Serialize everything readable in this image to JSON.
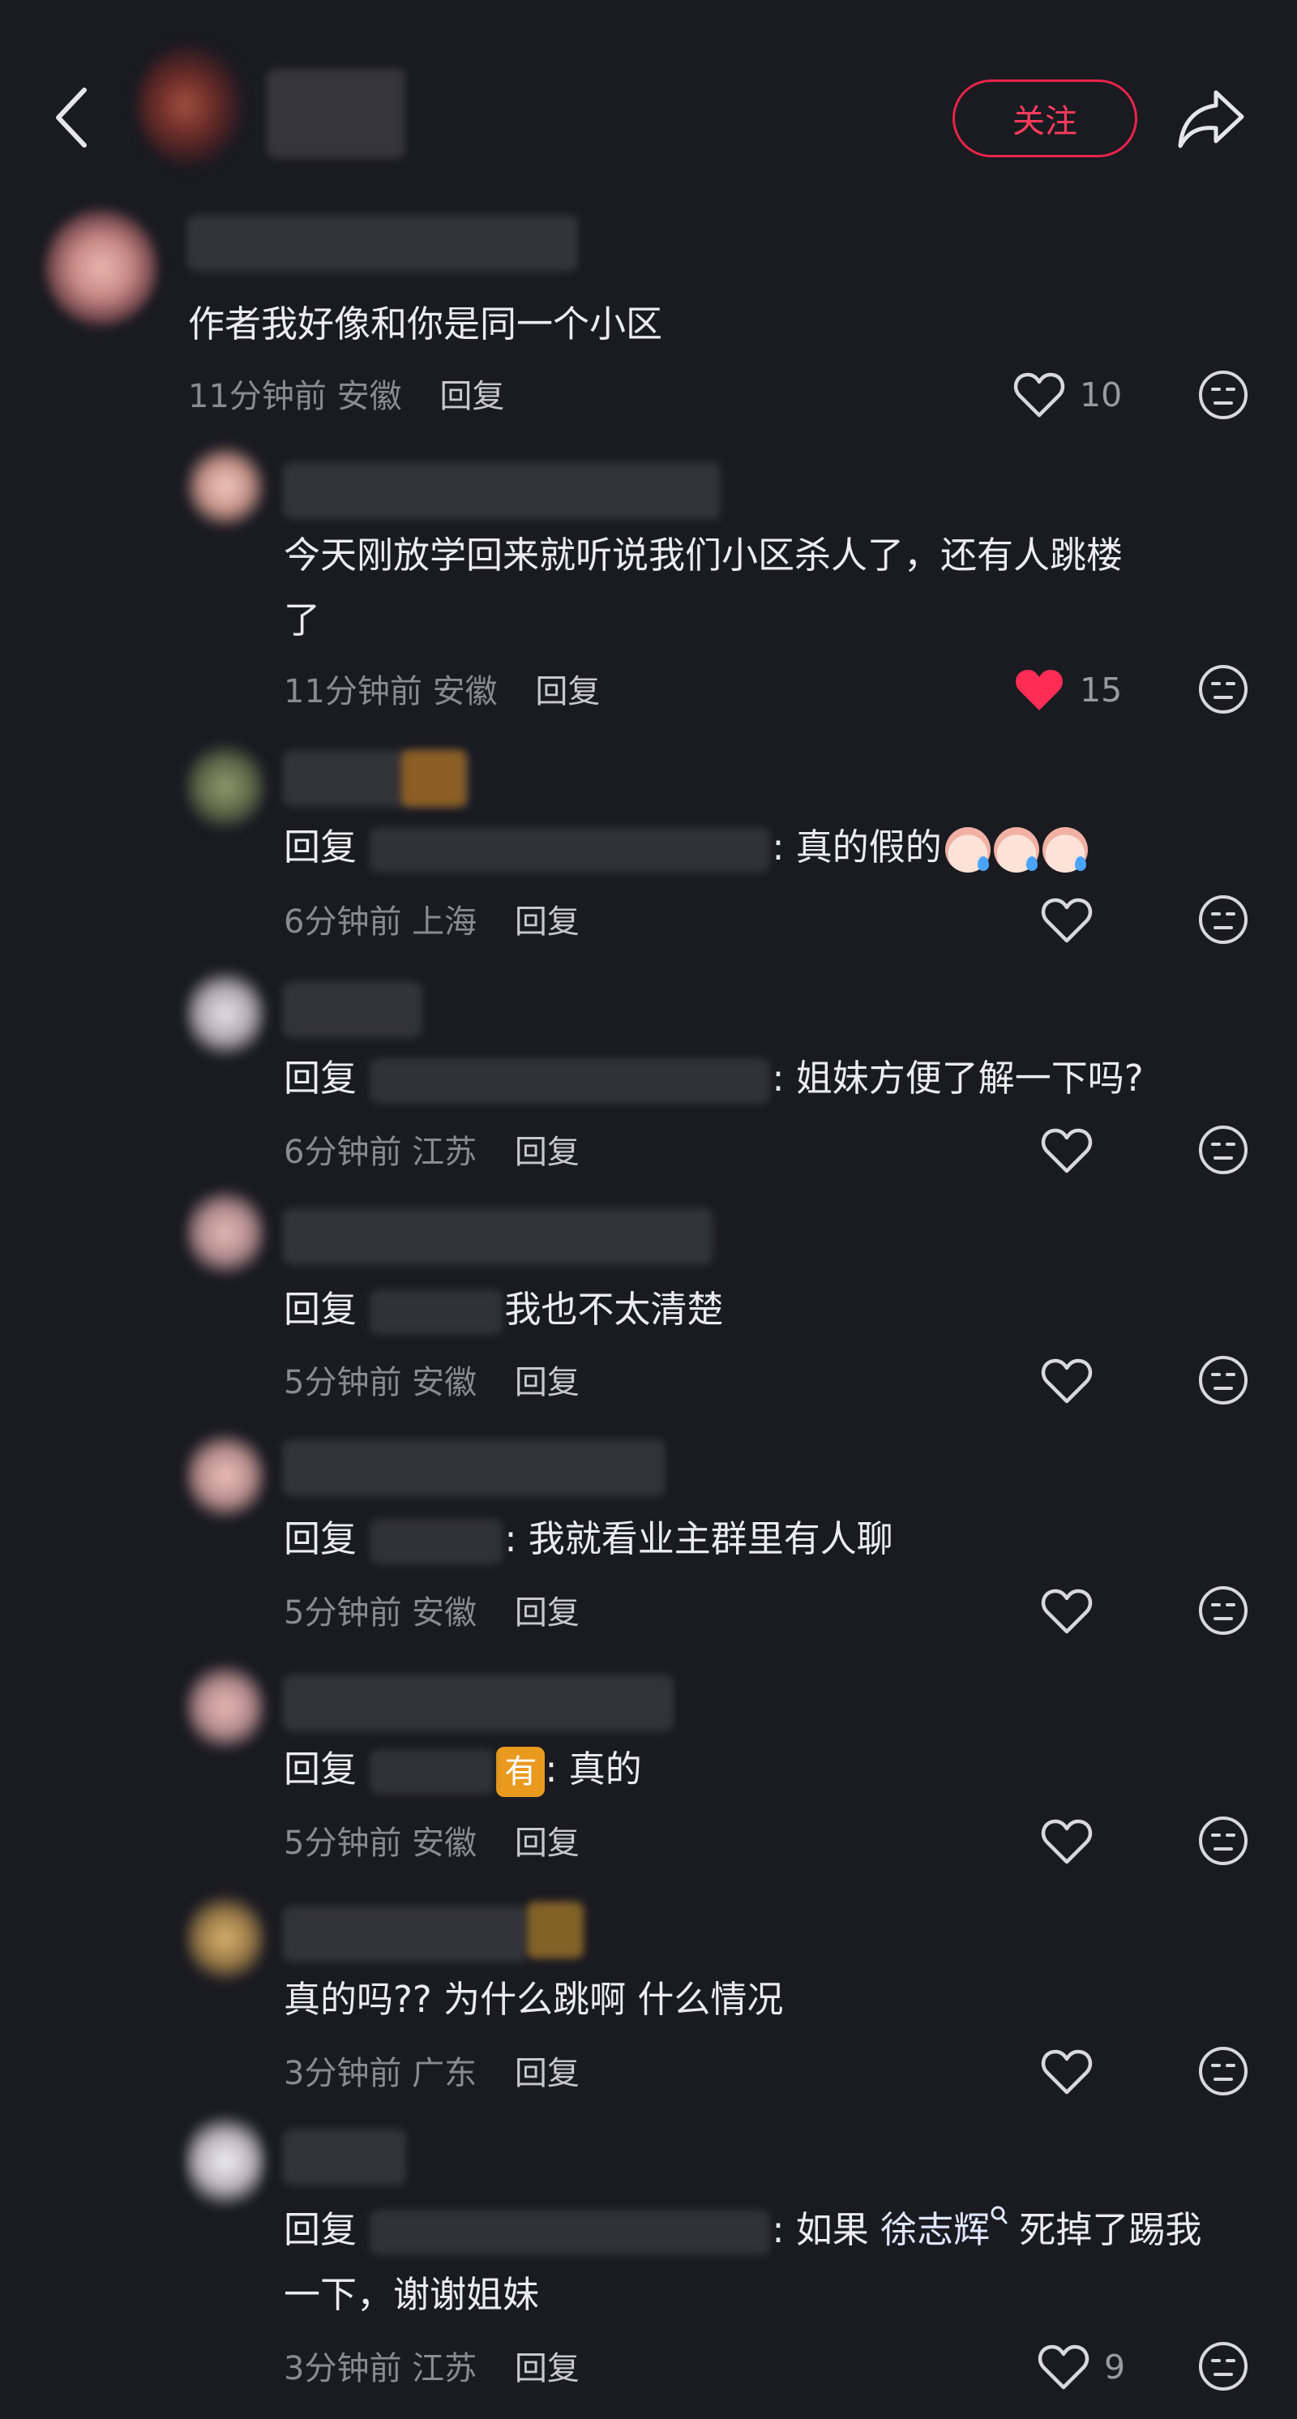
{
  "header": {
    "follow_label": "关注"
  },
  "main_comment": {
    "text": "作者我好像和你是同一个小区",
    "time": "11分钟前",
    "location": "安徽",
    "reply_label": "回复",
    "likes": "10"
  },
  "replies": [
    {
      "line1": "今天刚放学回来就听说我们小区杀人了，还有人跳楼",
      "line2": "了",
      "time": "11分钟前",
      "location": "安徽",
      "reply_label": "回复",
      "likes": "15",
      "liked": true
    },
    {
      "prefix": "回复",
      "body": ": 真的假的",
      "time": "6分钟前",
      "location": "上海",
      "reply_label": "回复"
    },
    {
      "prefix": "回复",
      "body": ": 姐妹方便了解一下吗?",
      "time": "6分钟前",
      "location": "江苏",
      "reply_label": "回复"
    },
    {
      "prefix": "回复",
      "body": "我也不太清楚",
      "time": "5分钟前",
      "location": "安徽",
      "reply_label": "回复"
    },
    {
      "prefix": "回复",
      "body": ": 我就看业主群里有人聊",
      "time": "5分钟前",
      "location": "安徽",
      "reply_label": "回复"
    },
    {
      "prefix": "回复",
      "emoji": "有",
      "body": ": 真的",
      "time": "5分钟前",
      "location": "安徽",
      "reply_label": "回复"
    },
    {
      "text": "真的吗?? 为什么跳啊 什么情况",
      "time": "3分钟前",
      "location": "广东",
      "reply_label": "回复"
    },
    {
      "prefix": "回复",
      "body_a": ": 如果 ",
      "mention": "徐志辉",
      "body_b": " 死掉了踢我",
      "line2": "一下，谢谢姐妹",
      "time": "3分钟前",
      "location": "江苏",
      "reply_label": "回复",
      "likes": "9"
    }
  ],
  "colors": {
    "accent": "#ff3b5c",
    "background": "#1a1a21"
  },
  "icons": [
    "back-arrow-icon",
    "share-icon",
    "heart-icon",
    "emoji-face-icon"
  ]
}
